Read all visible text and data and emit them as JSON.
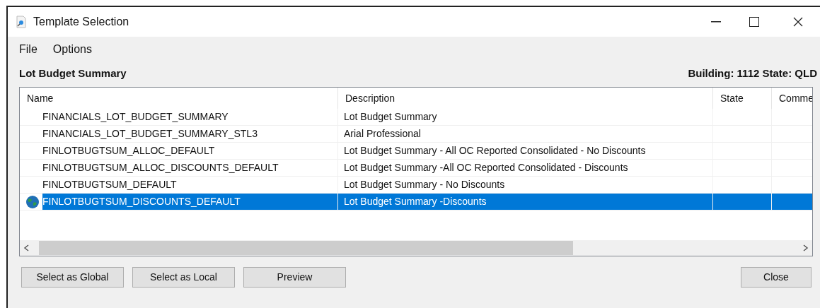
{
  "window": {
    "title": "Template Selection"
  },
  "menu": [
    "File",
    "Options"
  ],
  "header": {
    "title": "Lot Budget Summary",
    "info": "Building: 1112 State: QLD"
  },
  "table": {
    "columns": [
      "Name",
      "Description",
      "State",
      "Comme"
    ],
    "rows": [
      {
        "kind": "plain",
        "selected": false,
        "cells": [
          "FINANCIALS_LOT_BUDGET_SUMMARY",
          "Lot Budget Summary"
        ]
      },
      {
        "kind": "plain",
        "selected": false,
        "cells": [
          "FINANCIALS_LOT_BUDGET_SUMMARY_STL3",
          "Arial Professional"
        ]
      },
      {
        "kind": "plain",
        "selected": false,
        "cells": [
          "FINLOTBUGTSUM_ALLOC_DEFAULT",
          "Lot Budget Summary - All OC Reported Consolidated - No Discounts"
        ]
      },
      {
        "kind": "plain",
        "selected": false,
        "cells": [
          "FINLOTBUGTSUM_ALLOC_DISCOUNTS_DEFAULT",
          "Lot Budget Summary -All OC Reported Consolidated - Discounts"
        ]
      },
      {
        "kind": "plain",
        "selected": false,
        "cells": [
          "FINLOTBUGTSUM_DEFAULT",
          "Lot Budget Summary - No Discounts"
        ]
      },
      {
        "kind": "global",
        "selected": true,
        "cells": [
          "FINLOTBUGTSUM_DISCOUNTS_DEFAULT",
          "Lot Budget Summary -Discounts"
        ]
      }
    ]
  },
  "buttons": [
    "Select as Global",
    "Select as Local",
    "Preview"
  ],
  "close_button": "Close"
}
